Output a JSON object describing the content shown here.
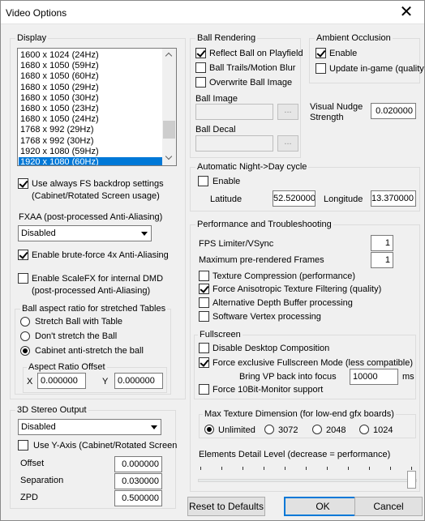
{
  "window": {
    "title": "Video Options",
    "close_glyph": "✕"
  },
  "display": {
    "legend": "Display",
    "resolutions": [
      "1600 x 1024 (24Hz)",
      "1680 x 1050 (59Hz)",
      "1680 x 1050 (60Hz)",
      "1680 x 1050 (29Hz)",
      "1680 x 1050 (30Hz)",
      "1680 x 1050 (23Hz)",
      "1680 x 1050 (24Hz)",
      "1768 x 992 (29Hz)",
      "1768 x 992 (30Hz)",
      "1920 x 1080 (59Hz)",
      "1920 x 1080 (60Hz)"
    ],
    "selected_index": 10,
    "scroll_position": 0.82,
    "fs_backdrop_label": "Use always FS backdrop settings",
    "fs_backdrop_label2": "(Cabinet/Rotated Screen usage)",
    "fs_backdrop_checked": true,
    "fxaa_label": "FXAA (post-processed Anti-Aliasing)",
    "fxaa_value": "Disabled",
    "brute_force_label": "Enable brute-force 4x Anti-Aliasing",
    "brute_force_checked": true,
    "scalefx_label": "Enable ScaleFX for internal DMD",
    "scalefx_label2": "(post-processed Anti-Aliasing)",
    "scalefx_checked": false
  },
  "aspect": {
    "legend": "Ball aspect ratio for stretched Tables",
    "options": [
      "Stretch Ball with Table",
      "Don't stretch the Ball",
      "Cabinet anti-stretch the ball"
    ],
    "selected": 2,
    "offset_legend": "Aspect Ratio Offset",
    "x_label": "X",
    "x_value": "0.000000",
    "y_label": "Y",
    "y_value": "0.000000"
  },
  "stereo": {
    "legend": "3D Stereo Output",
    "mode_value": "Disabled",
    "y_axis_label": "Use Y-Axis (Cabinet/Rotated Screen",
    "y_axis_checked": false,
    "offset_label": "Offset",
    "offset_value": "0.000000",
    "separation_label": "Separation",
    "separation_value": "0.030000",
    "zpd_label": "ZPD",
    "zpd_value": "0.500000"
  },
  "ball_rendering": {
    "legend": "Ball Rendering",
    "reflect_label": "Reflect Ball on Playfield",
    "reflect_checked": true,
    "trails_label": "Ball Trails/Motion Blur",
    "trails_checked": false,
    "overwrite_label": "Overwrite Ball Image",
    "overwrite_checked": false,
    "image_label": "Ball Image",
    "decal_label": "Ball Decal",
    "browse_label": "..."
  },
  "ambient": {
    "legend": "Ambient Occlusion",
    "enable_label": "Enable",
    "enable_checked": true,
    "update_label": "Update in-game (quality",
    "update_checked": false
  },
  "nudge": {
    "label_line1": "Visual Nudge",
    "label_line2": "Strength",
    "value": "0.020000"
  },
  "daynight": {
    "legend": "Automatic Night->Day cycle",
    "enable_label": "Enable",
    "enable_checked": false,
    "latitude_label": "Latitude",
    "latitude_value": "52.520000",
    "longitude_label": "Longitude",
    "longitude_value": "13.370000"
  },
  "perf": {
    "legend": "Performance and Troubleshooting",
    "fps_label": "FPS Limiter/VSync",
    "fps_value": "1",
    "prerender_label": "Maximum pre-rendered Frames",
    "prerender_value": "1",
    "tex_compress_label": "Texture Compression (performance)",
    "tex_compress_checked": false,
    "aniso_label": "Force Anisotropic Texture Filtering (quality)",
    "aniso_checked": true,
    "alt_depth_label": "Alternative Depth Buffer processing",
    "alt_depth_checked": false,
    "soft_vertex_label": "Software Vertex processing",
    "soft_vertex_checked": false
  },
  "fullscreen": {
    "legend": "Fullscreen",
    "desktop_comp_label": "Disable Desktop Composition",
    "desktop_comp_checked": false,
    "exclusive_label": "Force exclusive Fullscreen Mode (less compatible)",
    "exclusive_checked": true,
    "focus_label": "Bring VP back into focus",
    "focus_value": "10000",
    "focus_unit": "ms",
    "tenbit_label": "Force 10Bit-Monitor support",
    "tenbit_checked": false
  },
  "texture_dim": {
    "legend": "Max Texture Dimension (for low-end gfx boards)",
    "options": [
      "Unlimited",
      "3072",
      "2048",
      "1024"
    ],
    "selected": 0
  },
  "detail": {
    "label": "Elements Detail Level (decrease = performance)",
    "level_fraction": 1.0,
    "ticks": 11
  },
  "buttons": {
    "reset": "Reset to Defaults",
    "ok": "OK",
    "cancel": "Cancel"
  }
}
